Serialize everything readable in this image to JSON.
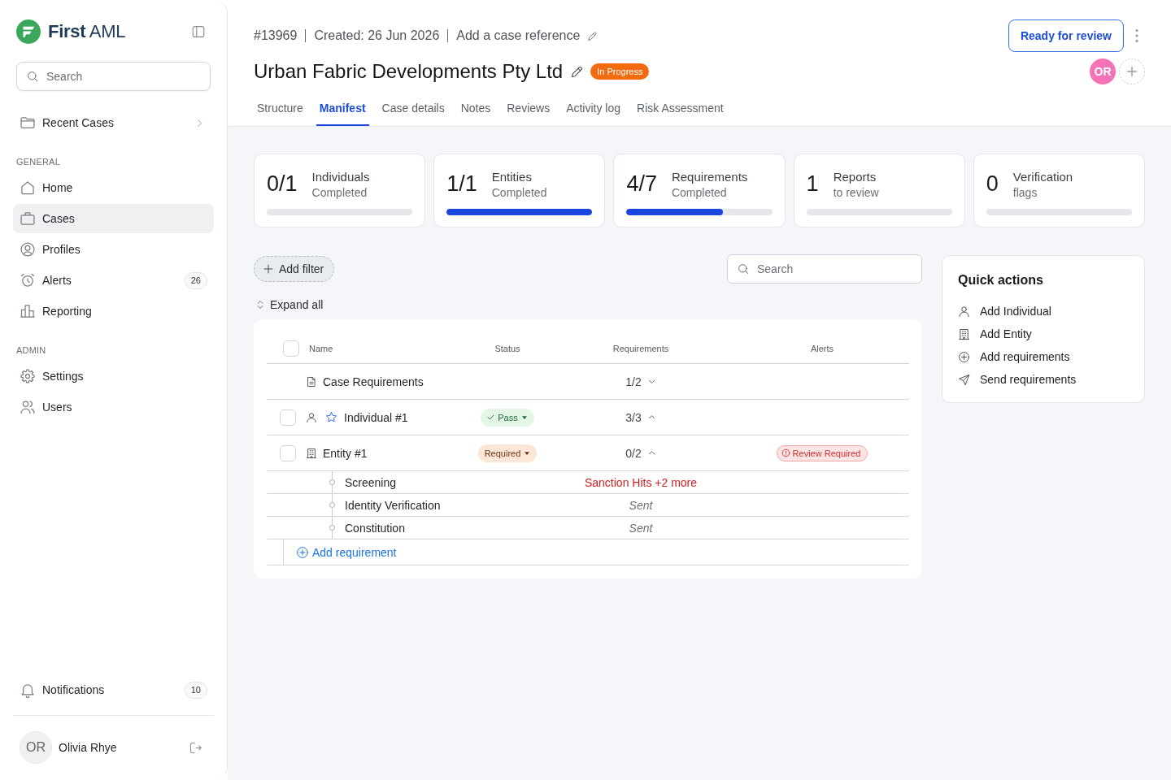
{
  "sidebar": {
    "logo": "**First** AML",
    "search": {
      "placeholder": "Search"
    },
    "recent_cases": {
      "label": "Recent Cases"
    },
    "sections": [
      {
        "heading": "GENERAL",
        "items": [
          {
            "label": "Home",
            "selected": false
          },
          {
            "label": "Cases",
            "selected": true
          },
          {
            "label": "Profiles",
            "selected": false
          },
          {
            "label": "Alerts",
            "selected": false,
            "badge": "26"
          },
          {
            "label": "Reporting",
            "selected": false
          }
        ]
      },
      {
        "heading": "ADMIN",
        "items": [
          {
            "label": "Settings",
            "selected": false
          },
          {
            "label": "Users",
            "selected": false
          }
        ]
      }
    ],
    "notifications": {
      "label": "Notifications",
      "badge": "10"
    },
    "user": {
      "initials": "OR",
      "name": "Olivia Rhye"
    }
  },
  "case_header": {
    "number": "#13969",
    "created": "Created: 26 Jun 2026",
    "reference": "Add a case reference",
    "title": "Urban Fabric Developments Pty Ltd",
    "status": "In Progress",
    "primary_action": "Ready for review",
    "assignee": {
      "initials": "OR"
    }
  },
  "tabs": [
    {
      "label": "Structure",
      "selected": false
    },
    {
      "label": "Manifest",
      "selected": true
    },
    {
      "label": "Case details",
      "selected": false
    },
    {
      "label": "Notes",
      "selected": false
    },
    {
      "label": "Reviews",
      "selected": false
    },
    {
      "label": "Activity log",
      "selected": false
    },
    {
      "label": "Risk Assessment",
      "selected": false
    }
  ],
  "stats": [
    {
      "value": "0/1",
      "label": "Individuals",
      "sublabel": "Completed",
      "level": 0
    },
    {
      "value": "1/1",
      "label": "Entities",
      "sublabel": "Completed",
      "level": 1
    },
    {
      "value": "4/7",
      "label": "Requirements",
      "sublabel": "Completed",
      "level": 0.66
    },
    {
      "value": "1",
      "label": "Reports",
      "sublabel": "to review",
      "level": 0
    },
    {
      "value": "0",
      "label": "Verification",
      "sublabel": "flags",
      "level": 0
    }
  ],
  "toolbar": {
    "add_filter": "Add filter",
    "search": {
      "placeholder": "Search"
    },
    "expand_all": "Expand all"
  },
  "table": {
    "columns": [
      "Name",
      "Status",
      "Requirements",
      "Alerts"
    ],
    "select_all": {
      "checked": false
    },
    "rows": [
      {
        "kind": "group",
        "name": "Case Requirements",
        "requirements": "1/2",
        "expanded": false
      },
      {
        "kind": "individual",
        "checked": false,
        "name": "Individual #1",
        "status": {
          "kind": "pass",
          "label": "Pass"
        },
        "requirements": "3/3",
        "expanded": true
      },
      {
        "kind": "entity",
        "checked": false,
        "name": "Entity #1",
        "status": {
          "kind": "required",
          "label": "Required"
        },
        "requirements": "0/2",
        "expanded": true,
        "alert": "Review Required",
        "children": [
          {
            "kind": "hits",
            "name": "Screening",
            "result": "Sanction Hits +2 more"
          },
          {
            "kind": "sent",
            "name": "Identity Verification",
            "result": "Sent"
          },
          {
            "kind": "sent",
            "name": "Constitution",
            "result": "Sent"
          }
        ]
      }
    ],
    "add_requirement": "Add requirement"
  },
  "quick_actions": {
    "title": "Quick actions",
    "items": [
      "Add Individual",
      "Add Entity",
      "Add requirements",
      "Send requirements"
    ]
  }
}
